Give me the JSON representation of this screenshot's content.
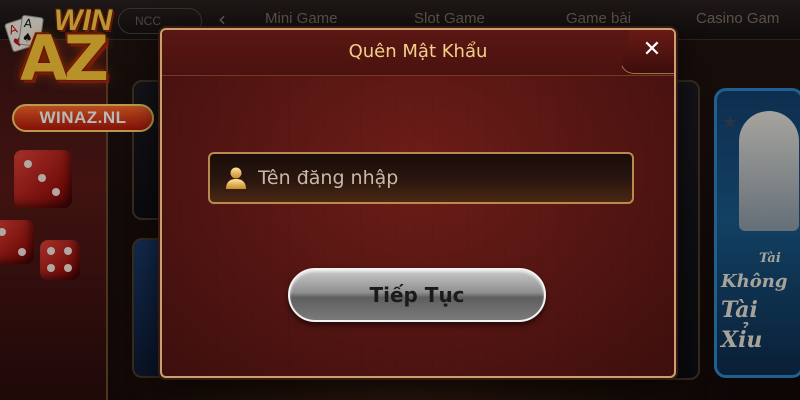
{
  "logo": {
    "win": "WIN",
    "az": "AZ",
    "domain": "WINAZ.NL"
  },
  "nav": {
    "filter_pill": "NCC",
    "tabs": [
      "Mini Game",
      "Slot Game",
      "Game bài",
      "Casino Gam"
    ]
  },
  "background_card": {
    "lines": [
      "Tài",
      "Không",
      "Tài",
      "Xỉu"
    ]
  },
  "modal": {
    "title": "Quên Mật Khẩu",
    "close_symbol": "✕",
    "username_placeholder": "Tên đăng nhập",
    "username_value": "",
    "continue_label": "Tiếp Tục"
  },
  "colors": {
    "modal_bg": "#5a1714",
    "gold_border": "#caa070",
    "title_gold": "#f2d08c",
    "button_silver": "#9a9a9a"
  },
  "icons": {
    "user": "user-icon",
    "close": "close-icon",
    "chevron": "chevron-left-icon"
  }
}
